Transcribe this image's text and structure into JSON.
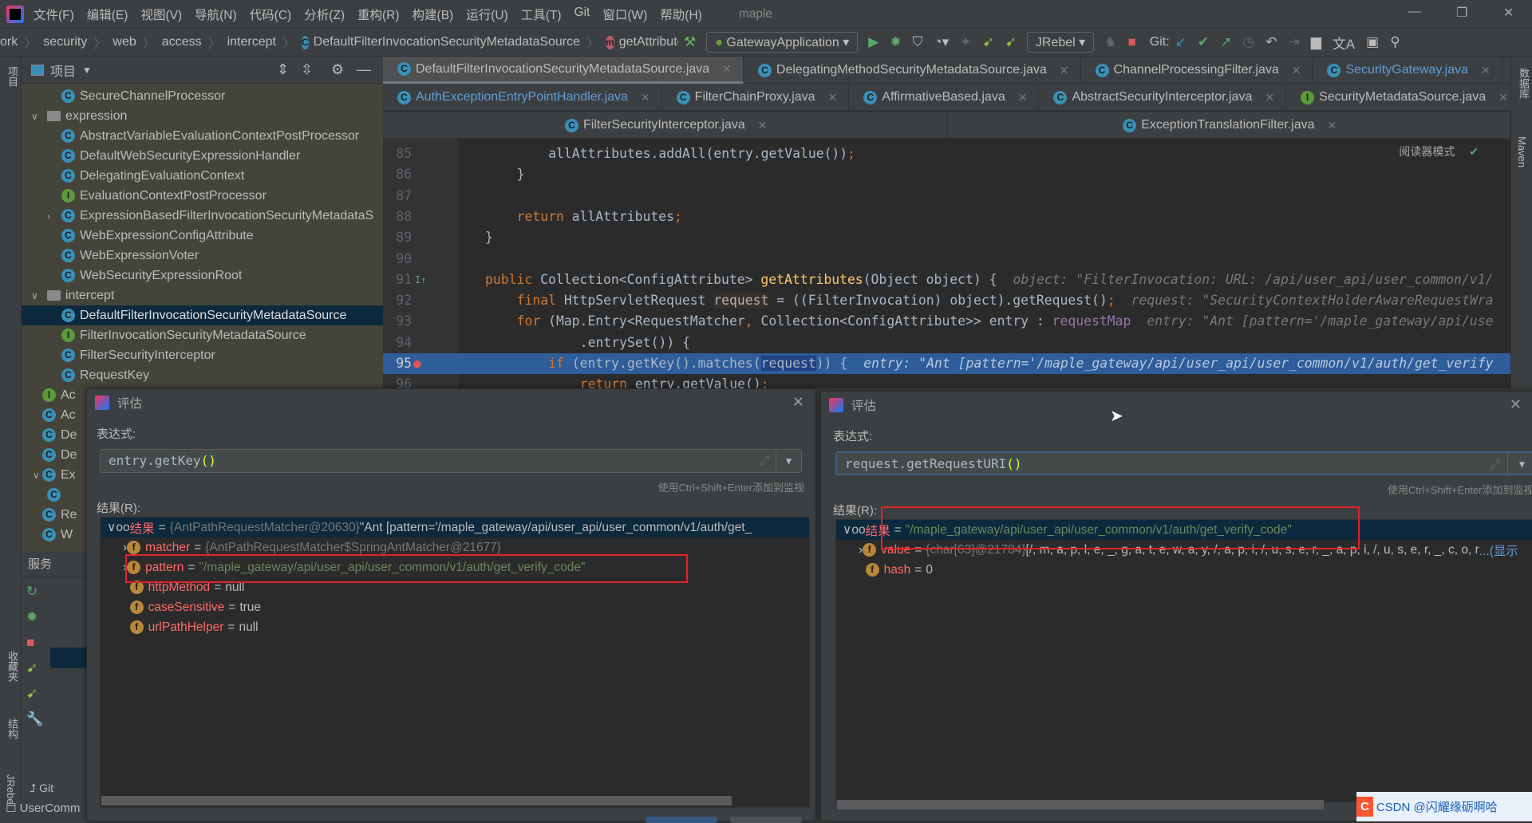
{
  "menubar": {
    "items": [
      "文件(F)",
      "编辑(E)",
      "视图(V)",
      "导航(N)",
      "代码(C)",
      "分析(Z)",
      "重构(R)",
      "构建(B)",
      "运行(U)",
      "工具(T)",
      "Git",
      "窗口(W)",
      "帮助(H)"
    ],
    "project_name": "maple"
  },
  "breadcrumb": [
    "ork",
    "security",
    "web",
    "access",
    "intercept",
    "DefaultFilterInvocationSecurityMetadataSource",
    "getAttributes"
  ],
  "toolbar": {
    "run_config": "GatewayApplication",
    "jrebel": "JRebel",
    "git_label": "Git:"
  },
  "left_stripe": {
    "project": "项目",
    "favorites": "收藏夹",
    "structure": "结构",
    "jrebel": "JRebel"
  },
  "right_stripe": {
    "database": "数据库",
    "maven": "Maven"
  },
  "project": {
    "title": "项目",
    "items": [
      {
        "label": "SecureChannelProcessor",
        "icon": "class",
        "level": 2
      },
      {
        "label": "expression",
        "icon": "folder",
        "level": 1,
        "expanded": true
      },
      {
        "label": "AbstractVariableEvaluationContextPostProcessor",
        "icon": "class",
        "level": 2
      },
      {
        "label": "DefaultWebSecurityExpressionHandler",
        "icon": "class",
        "level": 2
      },
      {
        "label": "DelegatingEvaluationContext",
        "icon": "class",
        "level": 2
      },
      {
        "label": "EvaluationContextPostProcessor",
        "icon": "interface",
        "level": 2
      },
      {
        "label": "ExpressionBasedFilterInvocationSecurityMetadataS",
        "icon": "class",
        "level": 2,
        "collapsed": true
      },
      {
        "label": "WebExpressionConfigAttribute",
        "icon": "class",
        "level": 2
      },
      {
        "label": "WebExpressionVoter",
        "icon": "class",
        "level": 2
      },
      {
        "label": "WebSecurityExpressionRoot",
        "icon": "class",
        "level": 2
      },
      {
        "label": "intercept",
        "icon": "folder",
        "level": 1,
        "expanded": true
      },
      {
        "label": "DefaultFilterInvocationSecurityMetadataSource",
        "icon": "class",
        "level": 2,
        "selected": true
      },
      {
        "label": "FilterInvocationSecurityMetadataSource",
        "icon": "interface",
        "level": 2
      },
      {
        "label": "FilterSecurityInterceptor",
        "icon": "class",
        "level": 2
      },
      {
        "label": "RequestKey",
        "icon": "class",
        "level": 2
      },
      {
        "label": "Ac",
        "icon": "interface",
        "level": 0
      },
      {
        "label": "Ac",
        "icon": "class",
        "level": 0
      },
      {
        "label": "De",
        "icon": "class",
        "level": 0
      },
      {
        "label": "De",
        "icon": "class",
        "level": 0
      },
      {
        "label": "Ex",
        "icon": "class",
        "level": 0,
        "expanded": true
      },
      {
        "label": "",
        "icon": "class",
        "level": 1
      },
      {
        "label": "Re",
        "icon": "class",
        "level": 0
      },
      {
        "label": "W",
        "icon": "class",
        "level": 0
      }
    ]
  },
  "services": {
    "title": "服务"
  },
  "bottom": {
    "git": "Git",
    "user_comm": "UserComm"
  },
  "editor": {
    "tab_rows": [
      [
        {
          "label": "DefaultFilterInvocationSecurityMetadataSource.java",
          "active": true
        },
        {
          "label": "DelegatingMethodSecurityMetadataSource.java"
        },
        {
          "label": "ChannelProcessingFilter.java"
        },
        {
          "label": "SecurityGateway.java",
          "blue": true
        }
      ],
      [
        {
          "label": "AuthExceptionEntryPointHandler.java",
          "blue": true
        },
        {
          "label": "FilterChainProxy.java"
        },
        {
          "label": "AffirmativeBased.java"
        },
        {
          "label": "AbstractSecurityInterceptor.java"
        },
        {
          "label": "SecurityMetadataSource.java",
          "icon": "interface"
        }
      ],
      [
        {
          "label": "FilterSecurityInterceptor.java"
        },
        {
          "label": "ExceptionTranslationFilter.java"
        }
      ]
    ],
    "reader_mode": "阅读器模式",
    "lines": [
      {
        "num": "85",
        "indent": 8,
        "tokens": [
          [
            "",
            "allAttributes.addAll(entry.getValue())"
          ],
          [
            "k",
            ";"
          ]
        ]
      },
      {
        "num": "86",
        "indent": 4,
        "tokens": [
          [
            "",
            "}"
          ]
        ]
      },
      {
        "num": "87",
        "indent": 0,
        "tokens": []
      },
      {
        "num": "88",
        "indent": 4,
        "tokens": [
          [
            "k",
            "return "
          ],
          [
            "",
            "allAttributes"
          ],
          [
            "k",
            ";"
          ]
        ]
      },
      {
        "num": "89",
        "indent": 0,
        "tokens": [
          [
            "",
            "}"
          ]
        ]
      },
      {
        "num": "90",
        "indent": 0,
        "tokens": []
      },
      {
        "num": "91",
        "indent": 0,
        "tokens": [
          [
            "k",
            "public "
          ],
          [
            "",
            "Collection<ConfigAttribute> "
          ],
          [
            "fn",
            "getAttributes"
          ],
          [
            "",
            "(Object object) {"
          ]
        ],
        "hint": "object: \"FilterInvocation: URL: /api/user_api/user_common/v1/"
      },
      {
        "num": "92",
        "indent": 4,
        "tokens": [
          [
            "k",
            "final "
          ],
          [
            "",
            "HttpServletRequest "
          ],
          [
            "hl",
            "request"
          ],
          [
            "",
            " = ((FilterInvocation) object).getRequest()"
          ],
          [
            "k",
            ";"
          ]
        ],
        "hint": "request: \"SecurityContextHolderAwareRequestWra"
      },
      {
        "num": "93",
        "indent": 4,
        "tokens": [
          [
            "k",
            "for "
          ],
          [
            "",
            "(Map.Entry<RequestMatcher"
          ],
          [
            "k",
            ", "
          ],
          [
            "",
            "Collection<ConfigAttribute>> entry : "
          ],
          [
            "fld",
            "requestMap"
          ]
        ],
        "hint": "entry: \"Ant [pattern='/maple_gateway/api/use"
      },
      {
        "num": "94",
        "indent": 12,
        "tokens": [
          [
            "",
            ".entrySet()) {"
          ]
        ]
      },
      {
        "num": "95",
        "indent": 8,
        "exec": true,
        "tokens": [
          [
            "k",
            "if "
          ],
          [
            "",
            "(entry.getKey().matches("
          ],
          [
            "selw",
            "request"
          ],
          [
            "",
            ")) {"
          ]
        ],
        "hint": "entry: \"Ant [pattern='/maple_gateway/api/user_api/user_common/v1/auth/get_verify"
      },
      {
        "num": "96",
        "indent": 12,
        "tokens": [
          [
            "k",
            "return "
          ],
          [
            "",
            "entry.getValue()"
          ],
          [
            "k",
            ";"
          ]
        ]
      }
    ]
  },
  "eval_left": {
    "title": "评估",
    "expr_label": "表达式:",
    "expression": "entry.getKey",
    "expr_parens": "()",
    "hint": "使用Ctrl+Shift+Enter添加到监视",
    "result_label": "结果(R):",
    "rows": [
      {
        "name": "结果",
        "type": "{AntPathRequestMatcher@20630}",
        "value": "\"Ant [pattern='/maple_gateway/api/user_api/user_common/v1/auth/get_",
        "root": true
      },
      {
        "name": "matcher",
        "type": "{AntPathRequestMatcher$SpringAntMatcher@21677}",
        "value": "",
        "expandable": true
      },
      {
        "name": "pattern",
        "type": "",
        "value": "\"/maple_gateway/api/user_api/user_common/v1/auth/get_verify_code\"",
        "string": true,
        "expandable": true
      },
      {
        "name": "httpMethod",
        "type": "",
        "value": "null"
      },
      {
        "name": "caseSensitive",
        "type": "",
        "value": "true"
      },
      {
        "name": "urlPathHelper",
        "type": "",
        "value": "null"
      }
    ]
  },
  "eval_right": {
    "title": "评估",
    "expr_label": "表达式:",
    "expression": "request.getRequestURI",
    "expr_parens": "()",
    "hint": "使用Ctrl+Shift+Enter添加到监视",
    "result_label": "结果(R):",
    "rows": [
      {
        "name": "结果",
        "type": "",
        "value": "\"/maple_gateway/api/user_api/user_common/v1/auth/get_verify_code\"",
        "string": true,
        "root": true
      },
      {
        "name": "value",
        "type": "{char[63]@21784}",
        "value": "[/, m, a, p, l, e, _, g, a, t, e, w, a, y, /, a, p, i, /, u, s, e, r, _, a, p, i, /, u, s, e, r, _, c, o, r",
        "more": "...(显示",
        "expandable": true
      },
      {
        "name": "hash",
        "type": "",
        "value": "0"
      }
    ]
  },
  "watermark": "CSDN @闪耀缘砺啊哈",
  "colors": {
    "editor_bg": "#2b2b2b",
    "panel_bg": "#3c3f41",
    "exec_line": "#2e5d9a",
    "keyword": "#cc7832",
    "string": "#6a8759",
    "highlight_box": "#e0242a"
  }
}
